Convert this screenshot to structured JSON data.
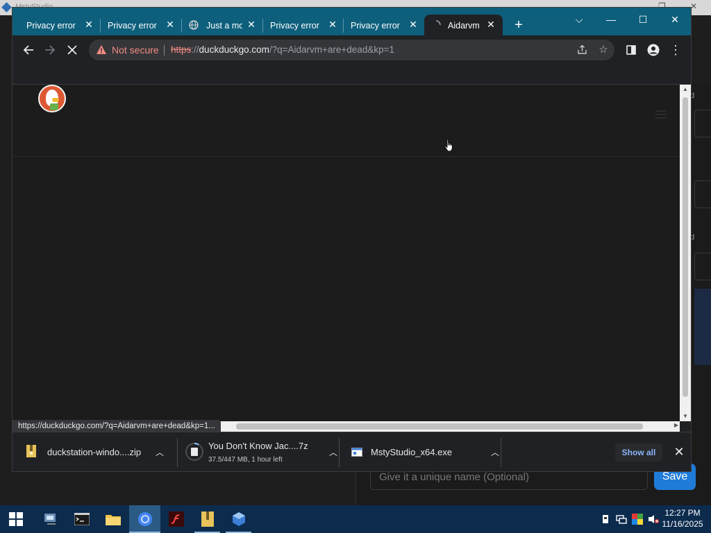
{
  "background_app": {
    "title": "MstyStudio",
    "side_labels": [
      "d",
      "d"
    ],
    "name_placeholder": "Give it a unique name (Optional)",
    "save_label": "Save"
  },
  "browser": {
    "tabs": [
      {
        "title": "Privacy error",
        "favicon": "blank-icon",
        "active": false
      },
      {
        "title": "Privacy error",
        "favicon": "blank-icon",
        "active": false
      },
      {
        "title": "Just a mo",
        "favicon": "globe-icon",
        "active": false
      },
      {
        "title": "Privacy error",
        "favicon": "blank-icon",
        "active": false
      },
      {
        "title": "Privacy error",
        "favicon": "blank-icon",
        "active": false
      },
      {
        "title": "Aidarvm a",
        "favicon": "loading-spinner-icon",
        "active": true
      }
    ],
    "new_tab_label": "+",
    "window_controls": {
      "tab_search": "⌵",
      "minimize": "—",
      "maximize": "☐",
      "close": "✕"
    },
    "security_label": "Not secure",
    "url": {
      "scheme": "https",
      "separator": "://",
      "host": "duckduckgo.com",
      "rest": "/?q=Aidarvm+are+dead&kp=1"
    },
    "status_url": "https://duckduckgo.com/?q=Aidarvm+are+dead&kp=1..."
  },
  "downloads": {
    "items": [
      {
        "name": "duckstation-windo....zip",
        "status": "",
        "icon": "zip-file-icon"
      },
      {
        "name": "You Don't Know Jac....7z",
        "status": "37.5/447 MB, 1 hour left",
        "icon": "download-progress-icon",
        "progress": 0.084
      },
      {
        "name": "MstyStudio_x64.exe",
        "status": "",
        "icon": "exe-file-icon"
      }
    ],
    "show_all_label": "Show all"
  },
  "taskbar": {
    "time": "12:27 PM",
    "date": "11/16/2025"
  }
}
